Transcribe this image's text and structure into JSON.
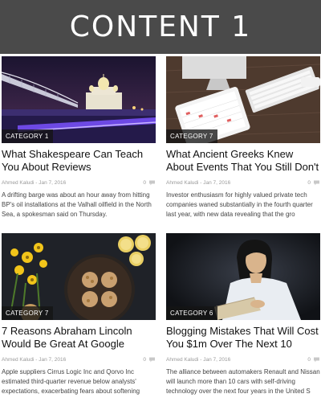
{
  "header": {
    "title": "CONTENT 1"
  },
  "posts": [
    {
      "category": "CATEGORY 1",
      "title": "What Shakespeare Can Teach You About Reviews",
      "author": "Ahmed Kaludi",
      "date": "Jan 7, 2016",
      "comments": "0",
      "excerpt": "A drifting barge was about an hour away from hitting BP's oil installations at the Valhall oilfield in the North Sea, a spokesman said on Thursday."
    },
    {
      "category": "CATEGORY 7",
      "title": "What Ancient Greeks Knew About Events That You Still Don't",
      "author": "Ahmed Kaludi",
      "date": "Jan 7, 2016",
      "comments": "0",
      "excerpt": "Investor enthusiasm for highly valued private tech companies waned substantially in the fourth quarter last year, with new data revealing that the gro"
    },
    {
      "category": "CATEGORY 7",
      "title": "7 Reasons Abraham Lincoln Would Be Great At Google Hangout",
      "author": "Ahmed Kaludi",
      "date": "Jan 7, 2016",
      "comments": "0",
      "excerpt": "Apple suppliers Cirrus Logic Inc and Qorvo Inc estimated third-quarter revenue below analysts' expectations, exacerbating fears about softening"
    },
    {
      "category": "CATEGORY 6",
      "title": "Blogging Mistakes That Will Cost You $1m Over The Next 10 Years",
      "author": "Ahmed Kaludi",
      "date": "Jan 7, 2016",
      "comments": "0",
      "excerpt": "The alliance between automakers Renault and Nissan will launch more than 10 cars with self-driving technology over the next four years in the United S"
    }
  ]
}
